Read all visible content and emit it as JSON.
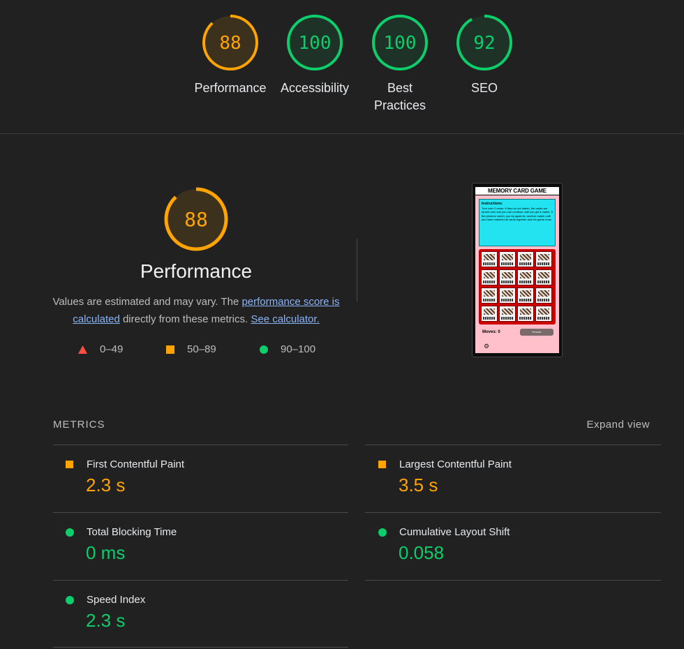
{
  "colors": {
    "average": "#ffa400",
    "pass": "#0cce6b",
    "fail": "#ff4e42",
    "link": "#8ab4f8"
  },
  "top_scores": [
    {
      "score": "88",
      "label": "Performance",
      "status": "average"
    },
    {
      "score": "100",
      "label": "Accessibility",
      "status": "pass"
    },
    {
      "score": "100",
      "label": "Best Practices",
      "status": "pass"
    },
    {
      "score": "92",
      "label": "SEO",
      "status": "pass"
    }
  ],
  "performance": {
    "score": "88",
    "title": "Performance",
    "desc_prefix": "Values are estimated and may vary. The ",
    "link_score": "performance score is calculated",
    "desc_middle": " directly from these metrics. ",
    "link_calculator": "See calculator.",
    "legend": [
      {
        "icon": "triangle-icon",
        "range": "0–49"
      },
      {
        "icon": "square-icon",
        "range": "50–89"
      },
      {
        "icon": "circle-icon",
        "range": "90–100"
      }
    ]
  },
  "screenshot": {
    "game_title": "MEMORY CARD GAME",
    "instructions_heading": "Instructions:",
    "instructions_text": "Turn over 2 cards. If they do not match, the cards are turned over and you can continue until you get a match. If the pictures match, you try again for another match until you have matched all cards together and the game ends.",
    "moves": "Moves: 0",
    "restart": "Restart"
  },
  "metrics": {
    "header": "METRICS",
    "expand": "Expand view",
    "items": [
      {
        "name": "First Contentful Paint",
        "value": "2.3 s",
        "status": "average"
      },
      {
        "name": "Largest Contentful Paint",
        "value": "3.5 s",
        "status": "average"
      },
      {
        "name": "Total Blocking Time",
        "value": "0 ms",
        "status": "pass"
      },
      {
        "name": "Cumulative Layout Shift",
        "value": "0.058",
        "status": "pass"
      },
      {
        "name": "Speed Index",
        "value": "2.3 s",
        "status": "pass"
      }
    ]
  }
}
